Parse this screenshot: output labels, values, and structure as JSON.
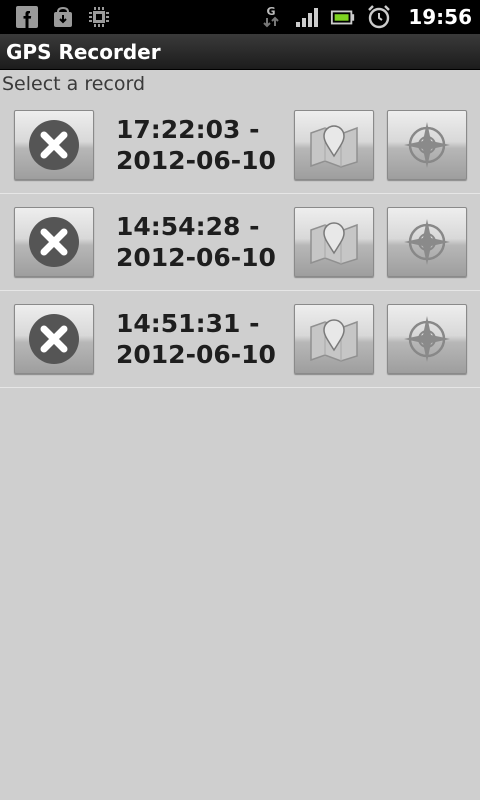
{
  "status_bar": {
    "time": "19:56",
    "network_label": "G",
    "icons": [
      "facebook-icon",
      "download-icon",
      "chip-icon",
      "network-g-icon",
      "signal-icon",
      "battery-icon",
      "alarm-clock-icon"
    ]
  },
  "app": {
    "title": "GPS Recorder"
  },
  "list": {
    "header": "Select a record",
    "records": [
      {
        "time_line": "17:22:03 -",
        "date_line": "2012-06-10"
      },
      {
        "time_line": "14:54:28 -",
        "date_line": "2012-06-10"
      },
      {
        "time_line": "14:51:31 -",
        "date_line": "2012-06-10"
      }
    ]
  },
  "colors": {
    "background": "#cfcfcf",
    "title_bar": "#1c1c1c",
    "status_bar": "#000000",
    "text": "#1e1e1e"
  }
}
